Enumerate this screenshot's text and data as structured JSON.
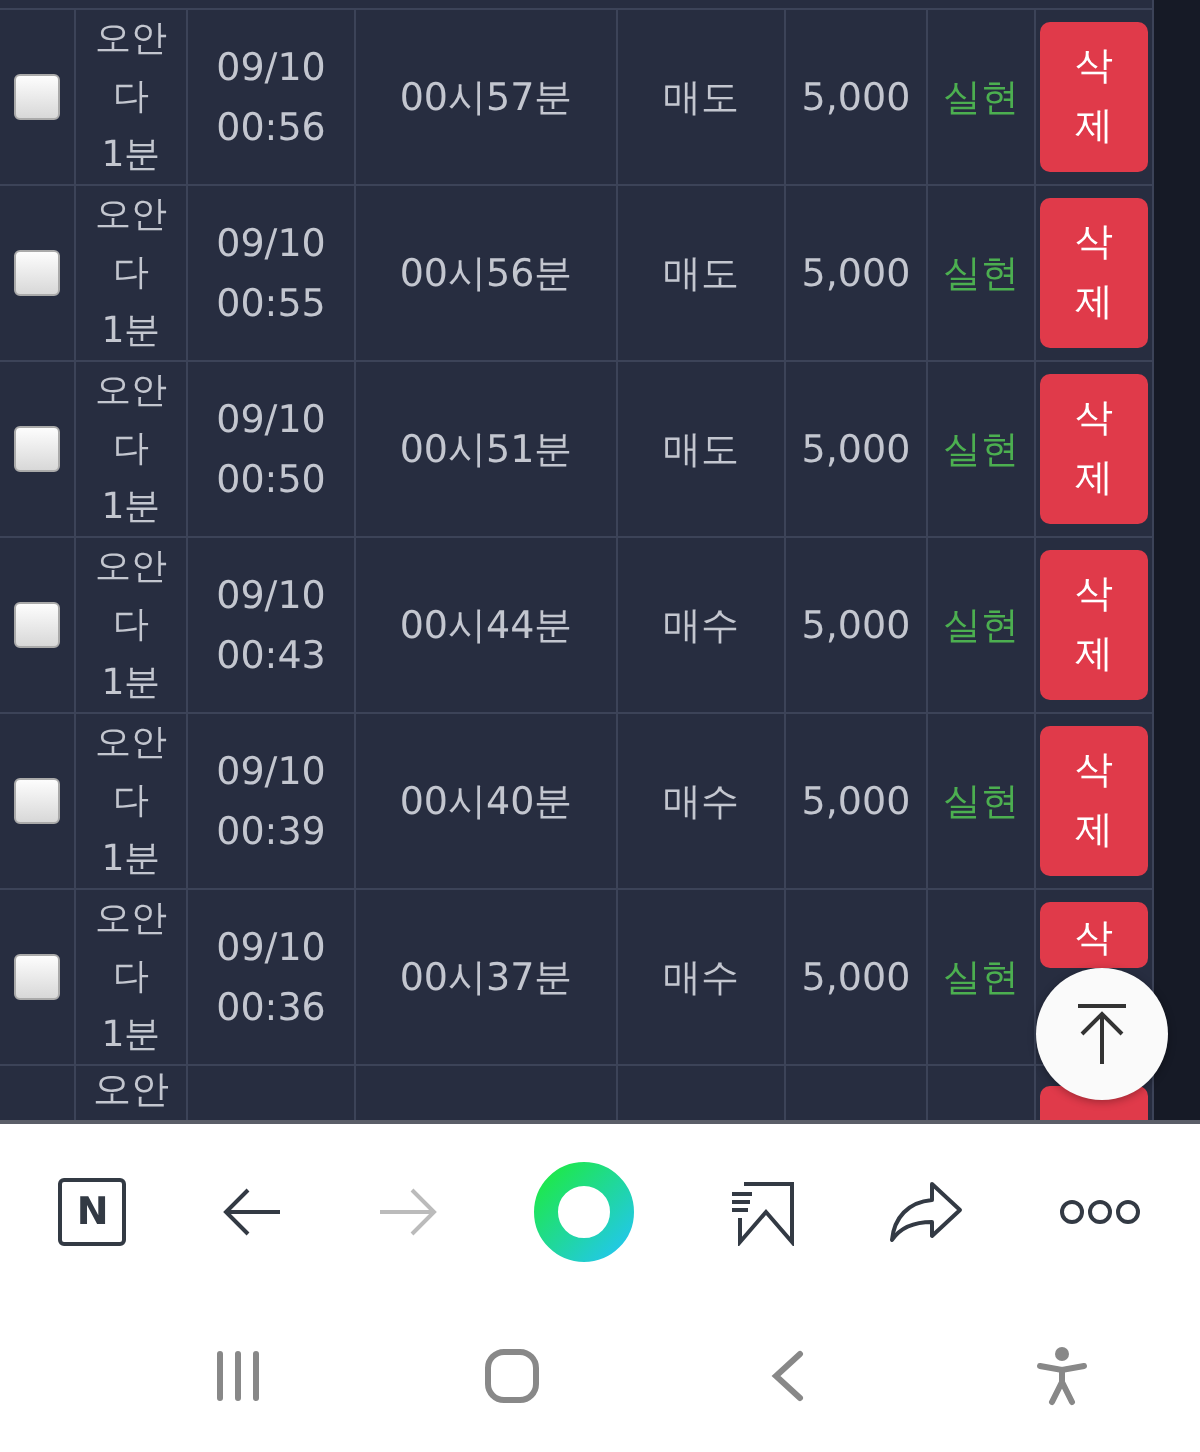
{
  "rows": [
    {
      "checked": false,
      "type": "오안다 1분",
      "datetime": "09/10 00:56",
      "time": "00시57분",
      "side": "매도",
      "amount": "5,000",
      "status": "실현",
      "delete": "삭제"
    },
    {
      "checked": false,
      "type": "오안다 1분",
      "datetime": "09/10 00:55",
      "time": "00시56분",
      "side": "매도",
      "amount": "5,000",
      "status": "실현",
      "delete": "삭제"
    },
    {
      "checked": false,
      "type": "오안다 1분",
      "datetime": "09/10 00:50",
      "time": "00시51분",
      "side": "매도",
      "amount": "5,000",
      "status": "실현",
      "delete": "삭제"
    },
    {
      "checked": false,
      "type": "오안다 1분",
      "datetime": "09/10 00:43",
      "time": "00시44분",
      "side": "매수",
      "amount": "5,000",
      "status": "실현",
      "delete": "삭제"
    },
    {
      "checked": false,
      "type": "오안다 1분",
      "datetime": "09/10 00:39",
      "time": "00시40분",
      "side": "매수",
      "amount": "5,000",
      "status": "실현",
      "delete": "삭제"
    },
    {
      "checked": false,
      "type": "오안다 1분",
      "datetime": "09/10 00:36",
      "time": "00시37분",
      "side": "매수",
      "amount": "5,000",
      "status": "실현",
      "delete": "삭"
    }
  ],
  "partial_row": {
    "type": "오안"
  },
  "toolbar": [
    {
      "kind": "tab-count",
      "label": "N"
    },
    {
      "kind": "back",
      "disabled": false
    },
    {
      "kind": "forward",
      "disabled": true
    },
    {
      "kind": "home"
    },
    {
      "kind": "bookmark"
    },
    {
      "kind": "share"
    },
    {
      "kind": "more"
    }
  ],
  "nav_bar": [
    {
      "kind": "recents"
    },
    {
      "kind": "home"
    },
    {
      "kind": "back"
    },
    {
      "kind": "accessibility"
    }
  ]
}
